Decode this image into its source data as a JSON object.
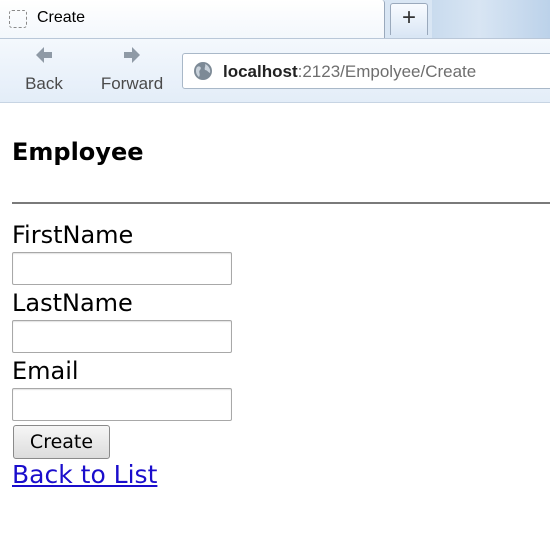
{
  "browser": {
    "tab_title": "Create",
    "new_tab_symbol": "+",
    "back_label": "Back",
    "forward_label": "Forward",
    "url_host": "localhost",
    "url_rest": ":2123/Empolyee/Create"
  },
  "page": {
    "title": "Employee",
    "fields": [
      {
        "label": "FirstName",
        "value": ""
      },
      {
        "label": "LastName",
        "value": ""
      },
      {
        "label": "Email",
        "value": ""
      }
    ],
    "submit_label": "Create",
    "back_link": "Back to List"
  },
  "colors": {
    "link": "#1a0dcc",
    "chrome_bg": "#d9e6f4",
    "divider": "#7a7a7a"
  },
  "icons": [
    "page-icon",
    "plus-icon",
    "back-arrow-icon",
    "forward-arrow-icon",
    "globe-icon"
  ]
}
